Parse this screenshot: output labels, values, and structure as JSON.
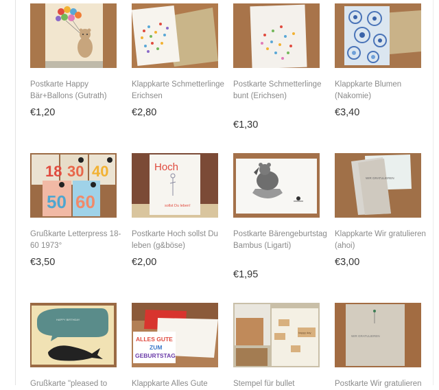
{
  "products": [
    {
      "title": "Postkarte Happy Bär+Ballons (Gutrath)",
      "price": "€1,20"
    },
    {
      "title": "Klappkarte Schmetterlinge Erichsen",
      "price": "€2,80"
    },
    {
      "title": "Postkarte Schmetterlinge bunt (Erichsen)",
      "price": "€1,30"
    },
    {
      "title": "Klappkarte Blumen (Nakomie)",
      "price": "€3,40"
    },
    {
      "title": "Grußkarte Letterpress 18-60 1973°",
      "price": "€3,50"
    },
    {
      "title": "Postkarte Hoch sollst Du leben (g&böse)",
      "price": "€2,00"
    },
    {
      "title": "Postkarte Bärengeburtstag Bambus (Ligarti)",
      "price": "€1,95"
    },
    {
      "title": "Klappkarte Wir gratulieren (ahoi)",
      "price": "€3,00"
    },
    {
      "title": "Grußkarte \"pleased to",
      "price": ""
    },
    {
      "title": "Klappkarte Alles Gute",
      "price": ""
    },
    {
      "title": "Stempel für bullet",
      "price": ""
    },
    {
      "title": "Postkarte Wir gratulieren",
      "price": ""
    }
  ],
  "card_texts": {
    "numbers": [
      "18",
      "30",
      "40",
      "50",
      "60"
    ],
    "hoch": "Hoch",
    "hoch_sub": "sollst Du leben!",
    "alles": [
      "ALLES GUTE",
      "ZUM",
      "GEBURTSTAG"
    ],
    "birthday": "HAPPY BIRTHDAY",
    "wir": "WIR GRATULIEREN",
    "stamp": "happy day"
  }
}
